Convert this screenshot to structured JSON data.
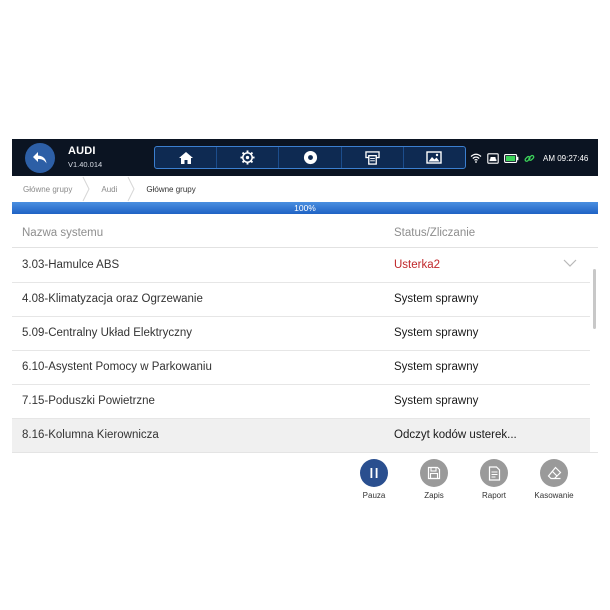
{
  "header": {
    "title": "AUDI",
    "version": "V1.40.014",
    "time": "AM 09:27:46",
    "accent": "#2d5fa6"
  },
  "toolbar": {
    "items": [
      {
        "icon": "home-icon"
      },
      {
        "icon": "gear-icon"
      },
      {
        "icon": "record-icon"
      },
      {
        "icon": "printer-icon"
      },
      {
        "icon": "image-icon"
      }
    ]
  },
  "status_icons": [
    "wifi-icon",
    "car-icon",
    "battery-icon",
    "link-icon"
  ],
  "breadcrumb": [
    "Główne grupy",
    "Audi",
    "Główne grupy"
  ],
  "progress": {
    "label": "100%",
    "percent": 100
  },
  "table": {
    "headers": {
      "name": "Nazwa systemu",
      "status": "Status/Zliczanie"
    },
    "rows": [
      {
        "name": "3.03-Hamulce ABS",
        "status": "Usterka2",
        "error": true
      },
      {
        "name": "4.08-Klimatyzacja oraz Ogrzewanie",
        "status": "System sprawny"
      },
      {
        "name": "5.09-Centralny Układ Elektryczny",
        "status": "System sprawny"
      },
      {
        "name": "6.10-Asystent Pomocy w Parkowaniu",
        "status": "System sprawny"
      },
      {
        "name": "7.15-Poduszki Powietrzne",
        "status": "System sprawny"
      },
      {
        "name": "8.16-Kolumna Kierownicza",
        "status": "Odczyt kodów usterek..."
      }
    ]
  },
  "actions": [
    {
      "label": "Pauza",
      "icon": "pause-icon",
      "color": "#2a4f8f"
    },
    {
      "label": "Zapis",
      "icon": "save-icon",
      "color": "#9a9a9a"
    },
    {
      "label": "Raport",
      "icon": "report-icon",
      "color": "#9a9a9a"
    },
    {
      "label": "Kasowanie",
      "icon": "eraser-icon",
      "color": "#9a9a9a"
    }
  ],
  "colors": {
    "error": "#c0282b",
    "topbar": "#0b1422",
    "progress": "#1f62c4"
  }
}
